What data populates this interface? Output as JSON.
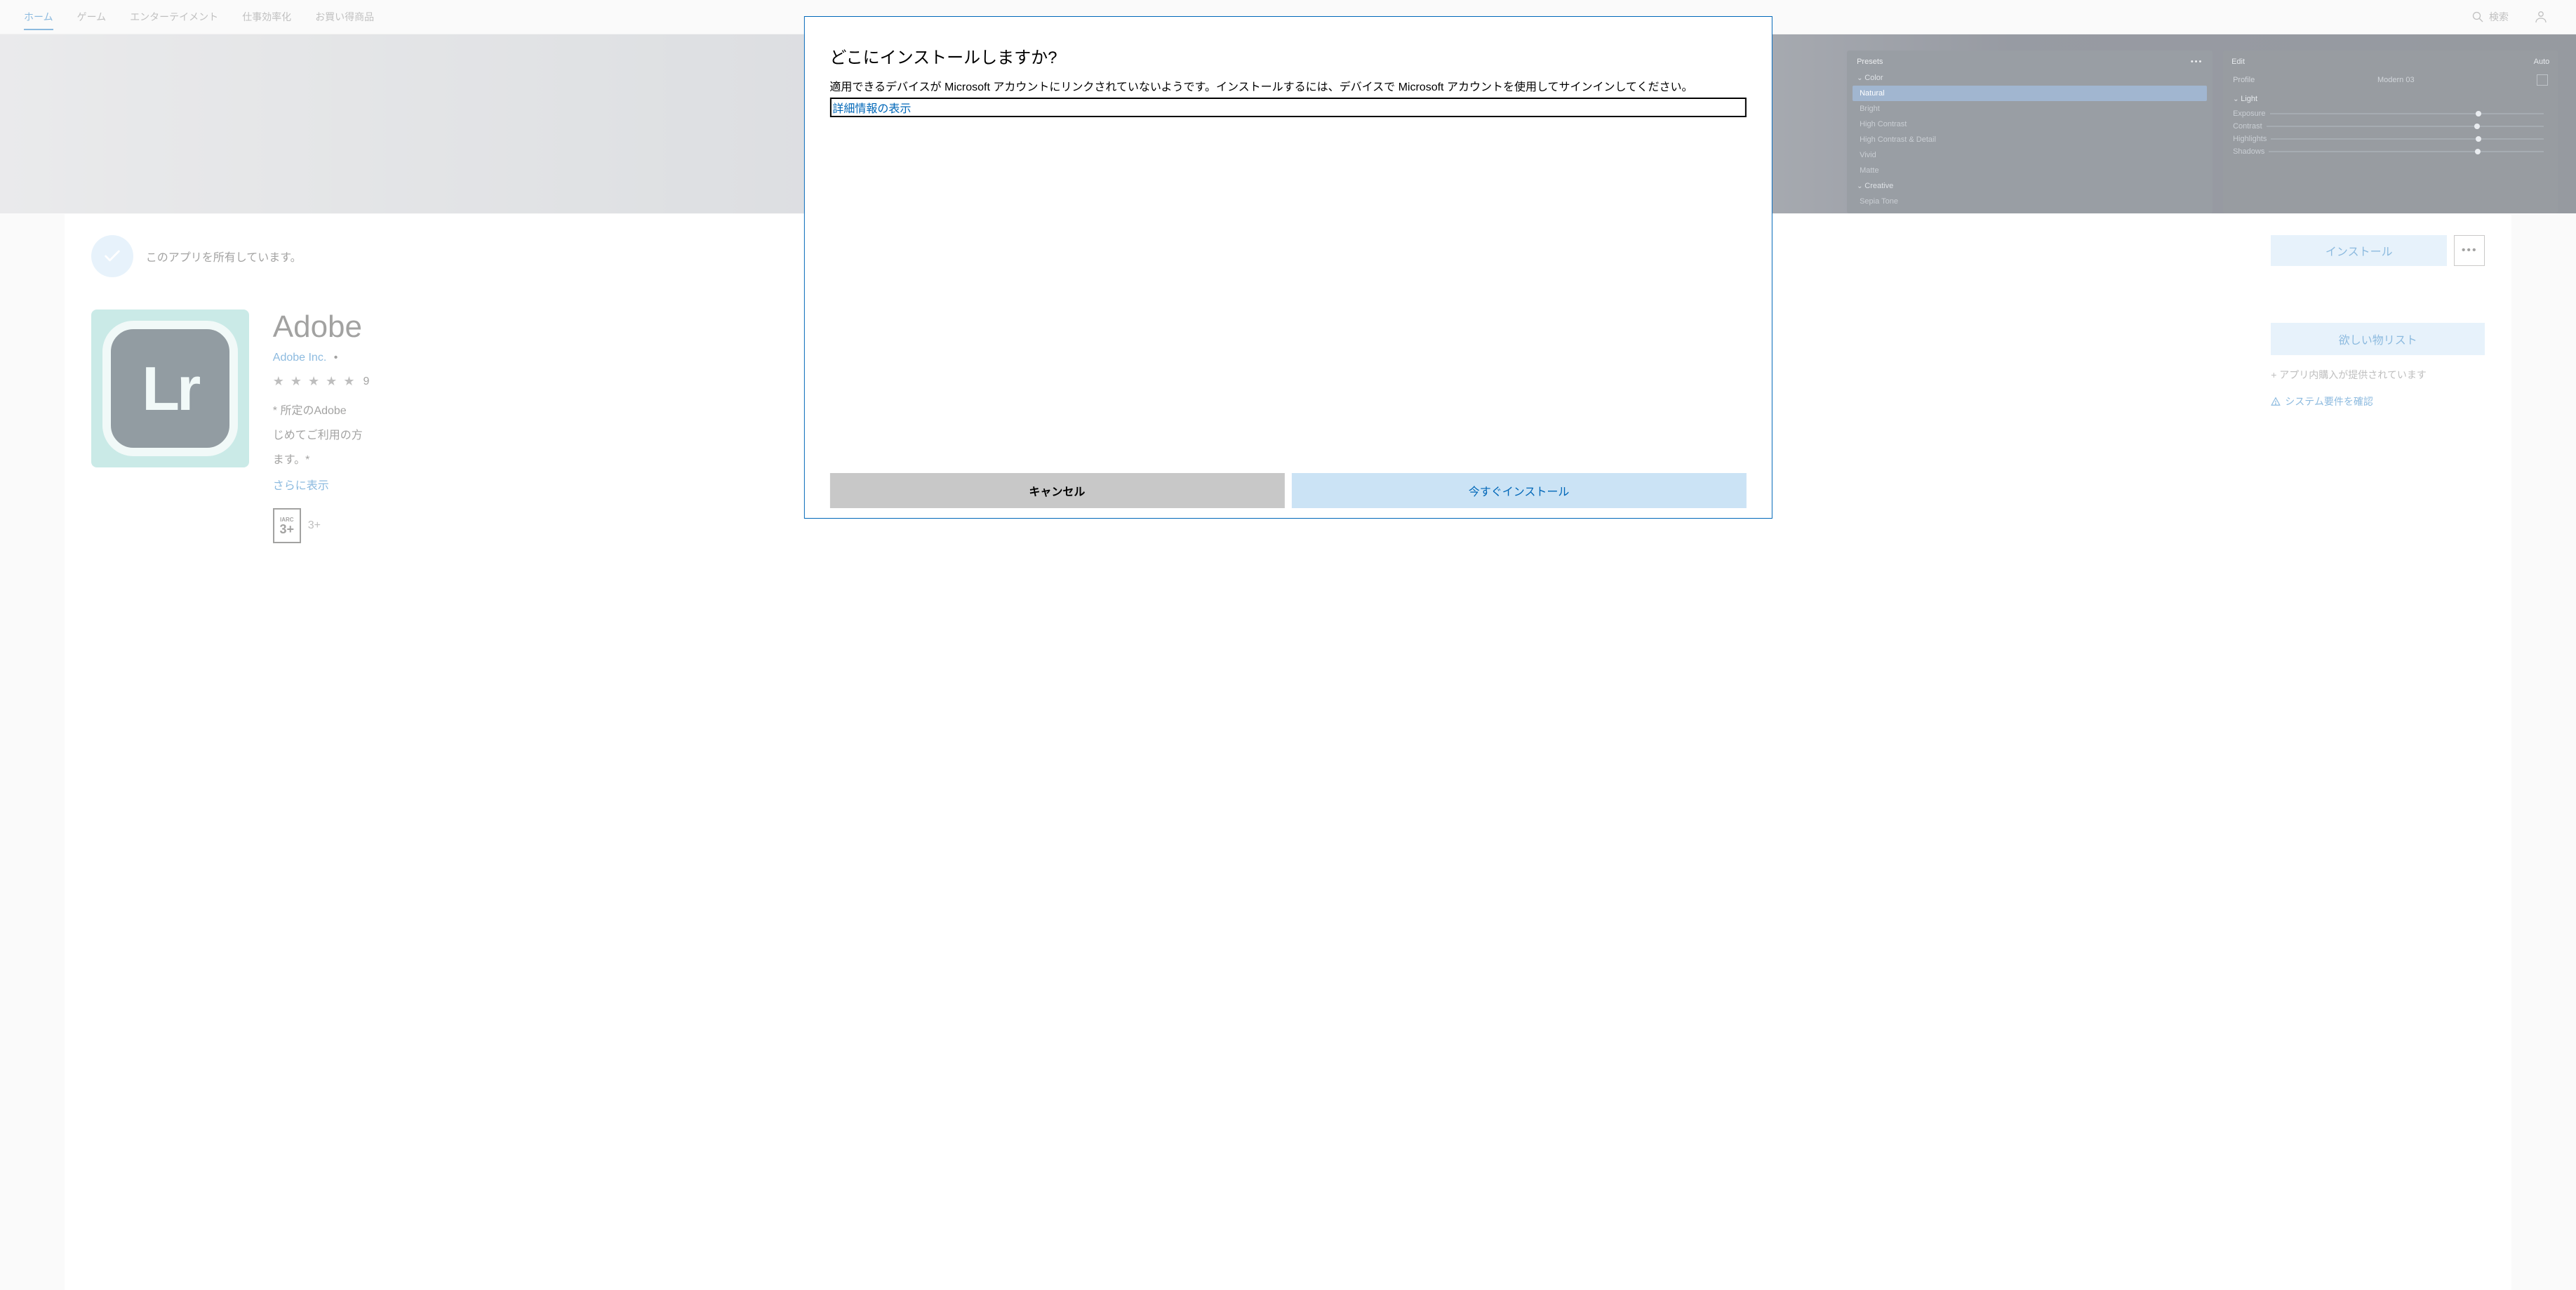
{
  "nav": {
    "home": "ホーム",
    "games": "ゲーム",
    "entertainment": "エンターテイメント",
    "productivity": "仕事効率化",
    "deals": "お買い得商品",
    "search": "検索"
  },
  "heroPresets": {
    "title": "Presets",
    "groupColor": "Color",
    "items": [
      "Natural",
      "Bright",
      "High Contrast",
      "High Contrast & Detail",
      "Vivid",
      "Matte"
    ],
    "groupCreative": "Creative",
    "creativeItems": [
      "Sepia Tone"
    ]
  },
  "heroEdit": {
    "title": "Edit",
    "auto": "Auto",
    "profileLabel": "Profile",
    "profileValue": "Modern 03",
    "lightGroup": "Light",
    "sliders": [
      "Exposure",
      "Contrast",
      "Highlights",
      "Shadows"
    ]
  },
  "owned": {
    "text": "このアプリを所有しています。"
  },
  "app": {
    "iconText": "Lr",
    "title": "Adobe",
    "publisher": "Adobe Inc.",
    "ratingStars": "★ ★ ★ ★ ★",
    "ratingCount": "9",
    "desc1": "* 所定のAdobe",
    "desc2": "じめてご利用の方",
    "desc3": "ます。*",
    "moreLink": "さらに表示",
    "iarcTop": "IARC",
    "iarcBig": "3+",
    "iarcLabel": "3+"
  },
  "actions": {
    "install": "インストール",
    "wishlist": "欲しい物リスト",
    "iap": "+ アプリ内購入が提供されています",
    "sysreq": "システム要件を確認"
  },
  "dialog": {
    "title": "どこにインストールしますか?",
    "body": "適用できるデバイスが Microsoft アカウントにリンクされていないようです。インストールするには、デバイスで Microsoft アカウントを使用してサインインしてください。",
    "link": "詳細情報の表示",
    "cancel": "キャンセル",
    "install": "今すぐインストール"
  }
}
